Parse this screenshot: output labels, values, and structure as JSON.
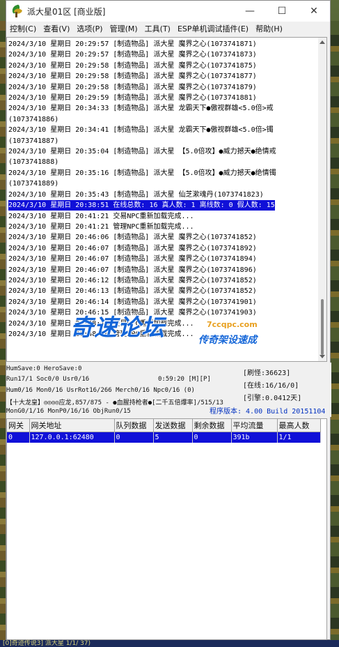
{
  "window": {
    "title": "派大星01区 [商业版]",
    "minimize": "—",
    "maximize": "☐",
    "close": "✕"
  },
  "menu": [
    "控制(C)",
    "查看(V)",
    "选项(P)",
    "管理(M)",
    "工具(T)",
    "ESP单机调试插件(E)",
    "帮助(H)"
  ],
  "log": [
    {
      "text": "2024/3/10 星期日 20:29:57 [制造物品] 派大星 魔界之心(1073741871)",
      "selected": false
    },
    {
      "text": "2024/3/10 星期日 20:29:57 [制造物品] 派大星 魔界之心(1073741873)",
      "selected": false
    },
    {
      "text": "2024/3/10 星期日 20:29:58 [制造物品] 派大星 魔界之心(1073741875)",
      "selected": false
    },
    {
      "text": "2024/3/10 星期日 20:29:58 [制造物品] 派大星 魔界之心(1073741877)",
      "selected": false
    },
    {
      "text": "2024/3/10 星期日 20:29:58 [制造物品] 派大星 魔界之心(1073741879)",
      "selected": false
    },
    {
      "text": "2024/3/10 星期日 20:29:59 [制造物品] 派大星 魔界之心(1073741881)",
      "selected": false
    },
    {
      "text": "2024/3/10 星期日 20:34:33 [制造物品] 派大星 龙霸天下●傲视群雄<5.0倍>戒",
      "selected": false
    },
    {
      "text": "(1073741886)",
      "selected": false
    },
    {
      "text": "2024/3/10 星期日 20:34:41 [制造物品] 派大星 龙霸天下●傲视群雄<5.0倍>镯",
      "selected": false
    },
    {
      "text": "(1073741887)",
      "selected": false
    },
    {
      "text": "2024/3/10 星期日 20:35:04 [制造物品] 派大星 【5.0倍攻】●威力撼天●绝情戒",
      "selected": false
    },
    {
      "text": "(1073741888)",
      "selected": false
    },
    {
      "text": "2024/3/10 星期日 20:35:16 [制造物品] 派大星 【5.0倍攻】●威力撼天●绝情镯",
      "selected": false
    },
    {
      "text": "(1073741889)",
      "selected": false
    },
    {
      "text": "2024/3/10 星期日 20:35:43 [制造物品] 派大星 仙芝漱魂丹(1073741823)",
      "selected": false
    },
    {
      "text": "2024/3/10 星期日 20:38:51 在线总数: 16 真人数: 1 离线数: 0 假人数: 15",
      "selected": true
    },
    {
      "text": "2024/3/10 星期日 20:41:21 交易NPC重新加载完成...",
      "selected": false
    },
    {
      "text": "2024/3/10 星期日 20:41:21 管理NPC重新加载完成...",
      "selected": false
    },
    {
      "text": "2024/3/10 星期日 20:46:06 [制造物品] 派大星 魔界之心(1073741852)",
      "selected": false
    },
    {
      "text": "2024/3/10 星期日 20:46:07 [制造物品] 派大星 魔界之心(1073741892)",
      "selected": false
    },
    {
      "text": "2024/3/10 星期日 20:46:07 [制造物品] 派大星 魔界之心(1073741894)",
      "selected": false
    },
    {
      "text": "2024/3/10 星期日 20:46:07 [制造物品] 派大星 魔界之心(1073741896)",
      "selected": false
    },
    {
      "text": "2024/3/10 星期日 20:46:12 [制造物品] 派大星 魔界之心(1073741852)",
      "selected": false
    },
    {
      "text": "2024/3/10 星期日 20:46:13 [制造物品] 派大星 魔界之心(1073741852)",
      "selected": false
    },
    {
      "text": "2024/3/10 星期日 20:46:14 [制造物品] 派大星 魔界之心(1073741901)",
      "selected": false
    },
    {
      "text": "2024/3/10 星期日 20:46:15 [制造物品] 派大星 魔界之心(1073741903)",
      "selected": false
    },
    {
      "text": "2024/3/10 星期日 20:48:16 交易NPC重新加载完成...",
      "selected": false
    },
    {
      "text": "2024/3/10 星期日 20:48:16 管理NPC重新加载完成...",
      "selected": false
    }
  ],
  "watermark": {
    "main": "奇速论坛",
    "url": "7ccqpc.com",
    "sub": "传奇架设速成"
  },
  "status": {
    "line1": "HumSave:0 HeroSave:0",
    "line2a": "Run17/1 Soc0/0 Usr0/16",
    "line2b": "0:59:20 [M][P]",
    "line3": "Hum0/16 Mon0/16 UsrRot16/266 Merch0/16 Npc0/16 (0)",
    "line4": "【十大龙皇】◎◎◎◎应龙,857/875 - ●血腥持枪者●[二千五倍爆率]/515/13",
    "line5": "MonG0/1/16 MonP0/16/16 ObjRun0/15",
    "refresh": "[刷怪:36623]",
    "online": "[在线:16/16/0]",
    "engine": "[引擎:0.0412天]",
    "version": "程序版本: 4.00 Build 20151104"
  },
  "grid": {
    "columns": [
      "网关",
      "网关地址",
      "队列数据",
      "发送数据",
      "剩余数据",
      "平均流量",
      "最高人数"
    ],
    "rows": [
      [
        "0",
        "127.0.0.1:62480",
        "0",
        "5",
        "0",
        "391b",
        "1/1"
      ]
    ]
  },
  "bottom_text": "[0]奇迹传说3] 派大星 1/1/ 37)",
  "colors": {
    "selection": "#1010d8",
    "watermark_blue": "#1466d8",
    "watermark_orange": "#e8a020",
    "version_blue": "#0030c0"
  }
}
